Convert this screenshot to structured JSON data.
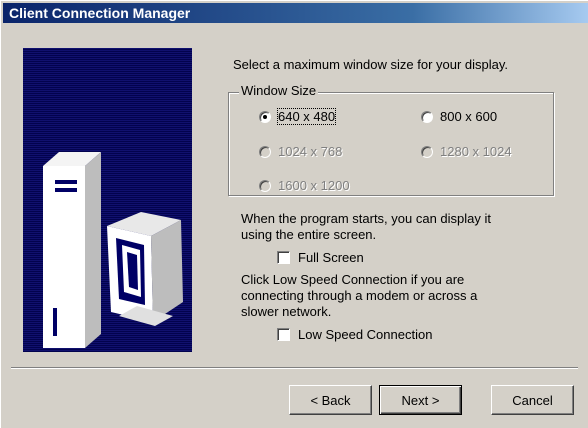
{
  "window": {
    "title": "Client Connection Manager"
  },
  "prompt": "Select a maximum window size for your display.",
  "window_size_group": {
    "legend": "Window Size",
    "options": [
      {
        "label": "640 x 480",
        "selected": true,
        "enabled": true
      },
      {
        "label": "800 x 600",
        "selected": false,
        "enabled": true
      },
      {
        "label": "1024 x 768",
        "selected": false,
        "enabled": false
      },
      {
        "label": "1280 x 1024",
        "selected": false,
        "enabled": false
      },
      {
        "label": "1600 x 1200",
        "selected": false,
        "enabled": false
      }
    ]
  },
  "full_screen": {
    "description_line1": "When the program starts, you can display it",
    "description_line2": "using the entire screen.",
    "label": "Full Screen",
    "checked": false
  },
  "low_speed": {
    "description_line1": "Click Low Speed Connection if you are",
    "description_line2": "connecting through a modem or across a",
    "description_line3": "slower network.",
    "label": "Low Speed Connection",
    "checked": false
  },
  "buttons": {
    "back": "< Back",
    "next": "Next >",
    "cancel": "Cancel"
  },
  "colors": {
    "title_bar": "#0a246a",
    "dialog_face": "#d4d0c8",
    "art_background": "#000066"
  }
}
